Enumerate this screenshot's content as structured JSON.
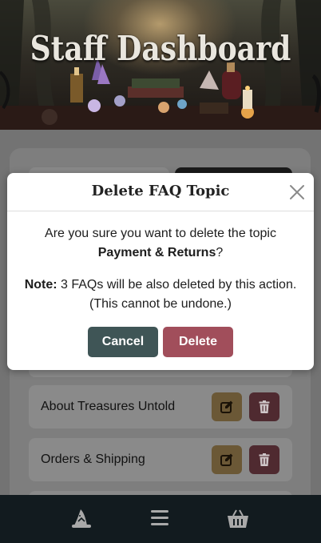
{
  "header": {
    "title": "Staff Dashboard"
  },
  "topics": [
    {
      "label": "About Treasures Untold"
    },
    {
      "label": "Orders & Shipping"
    }
  ],
  "modal": {
    "title": "Delete FAQ Topic",
    "question": "Are you sure you want to delete the topic",
    "topic_name": "Payment & Returns",
    "question_end": "?",
    "note_label": "Note:",
    "note_text": " 3 FAQs will be also deleted by this action.",
    "note_line2": "(This cannot be undone.)",
    "cancel_label": "Cancel",
    "delete_label": "Delete"
  },
  "icons": {
    "close": "close-icon",
    "edit": "edit-icon",
    "trash": "trash-icon",
    "nav_home": "wizard-hat-icon",
    "nav_menu": "menu-icon",
    "nav_cart": "basket-icon"
  },
  "colors": {
    "cancel": "#3f5556",
    "delete": "#a14e5b",
    "edit_button": "#c9a14f",
    "delete_button": "#8e3f4e",
    "nav_background": "#121b1f"
  }
}
